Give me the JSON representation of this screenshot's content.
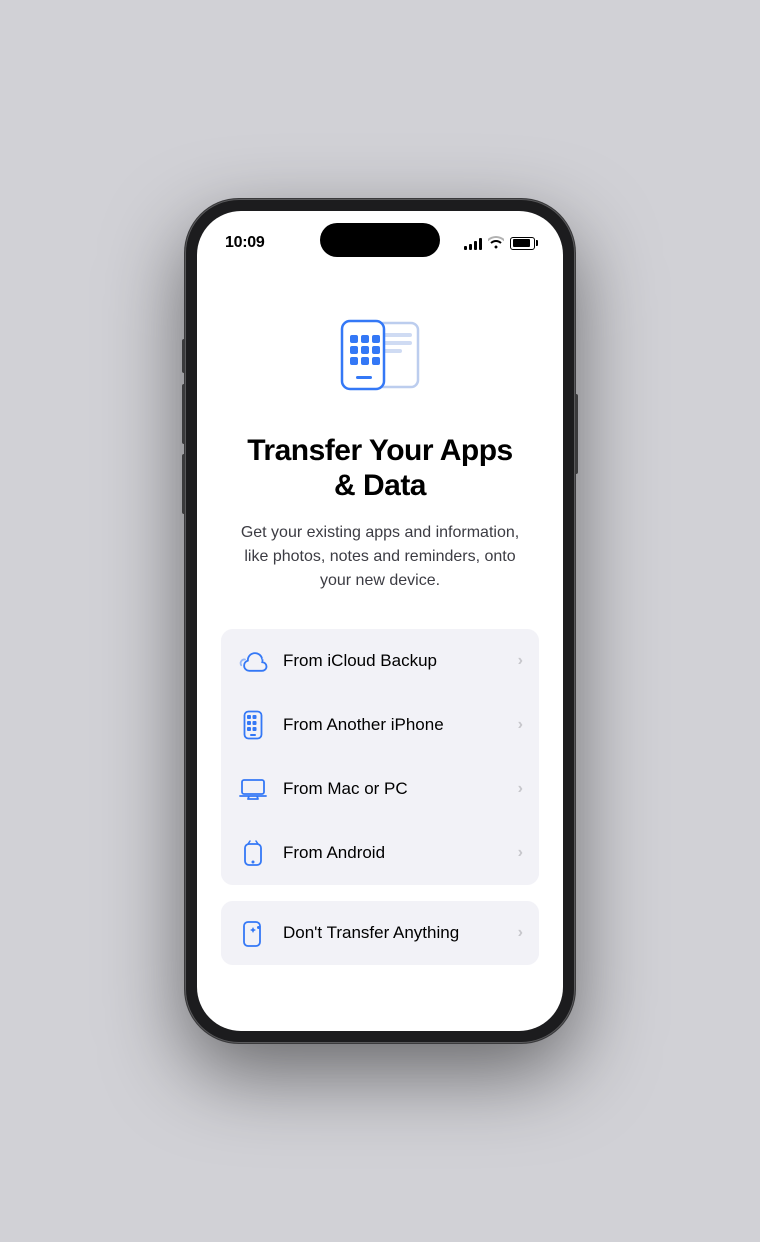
{
  "status_bar": {
    "time": "10:09",
    "signal_bars": [
      4,
      6,
      9,
      12,
      14
    ],
    "wifi": "wifi",
    "battery_percent": 85
  },
  "page": {
    "title": "Transfer Your Apps\n& Data",
    "subtitle": "Get your existing apps and information, like photos, notes and reminders, onto your new device.",
    "options": [
      {
        "id": "icloud",
        "label": "From iCloud Backup",
        "icon": "cloud"
      },
      {
        "id": "iphone",
        "label": "From Another iPhone",
        "icon": "iphone"
      },
      {
        "id": "mac-pc",
        "label": "From Mac or PC",
        "icon": "laptop"
      },
      {
        "id": "android",
        "label": "From Android",
        "icon": "android-phone"
      }
    ],
    "bottom_option": {
      "id": "no-transfer",
      "label": "Don't Transfer Anything",
      "icon": "sparkle-phone"
    }
  }
}
